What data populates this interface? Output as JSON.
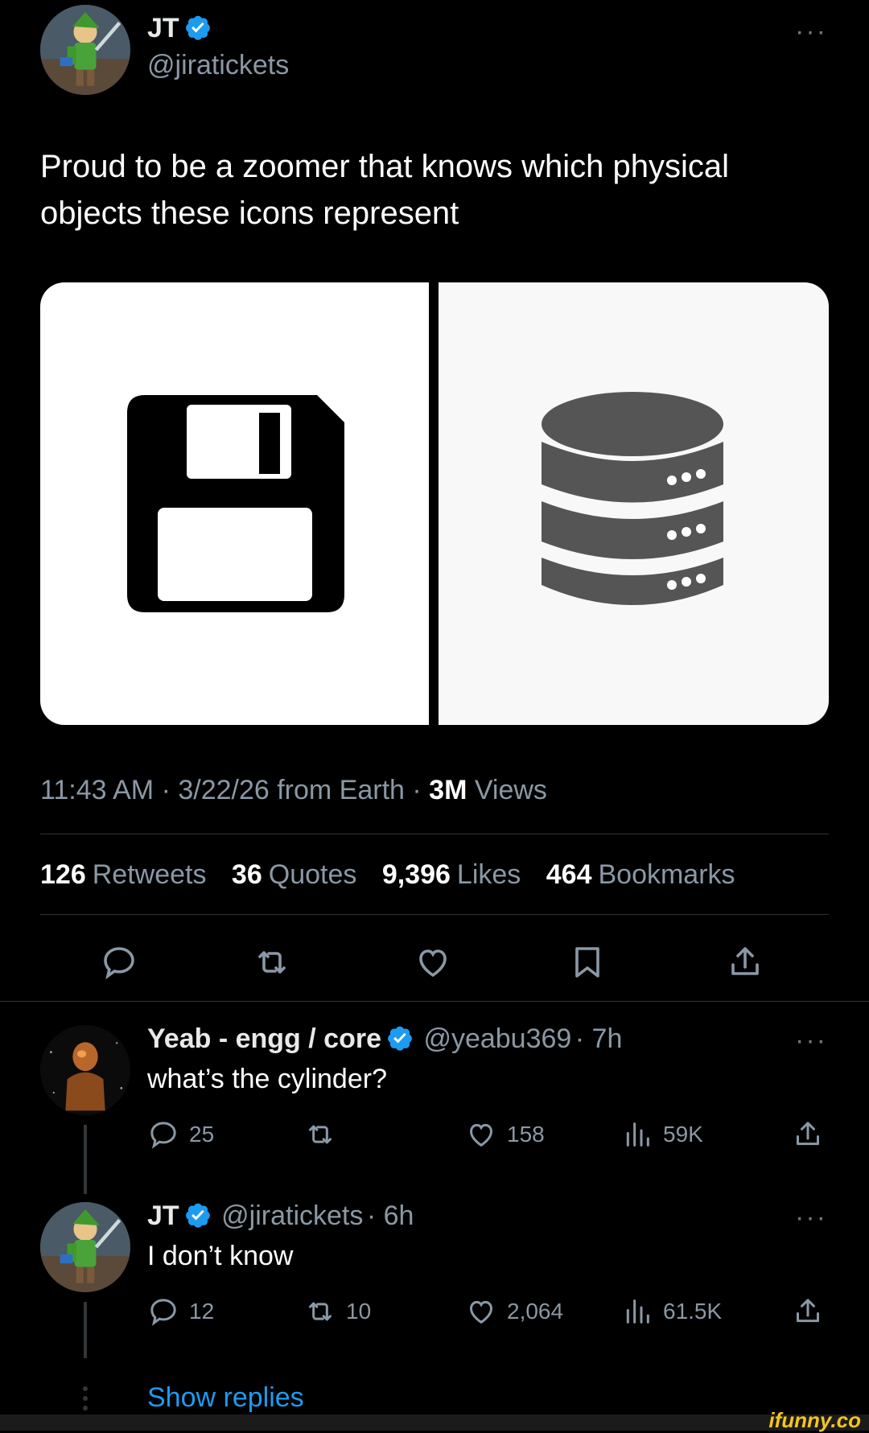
{
  "tweet": {
    "author_name": "JT",
    "author_handle": "@jiratickets",
    "more_label": "···",
    "text": "Proud to be a zoomer that knows which physical objects these icons represent",
    "time": "11:43 AM · 3/22/26 from Earth · ",
    "views_count": "3M",
    "views_label": " Views",
    "stats": {
      "retweets_count": "126",
      "retweets_label": "Retweets",
      "quotes_count": "36",
      "quotes_label": "Quotes",
      "likes_count": "9,396",
      "likes_label": "Likes",
      "bookmarks_count": "464",
      "bookmarks_label": "Bookmarks"
    },
    "media": [
      {
        "icon": "floppy-disk-icon"
      },
      {
        "icon": "database-icon"
      }
    ]
  },
  "replies": [
    {
      "name": "Yeab - engg / core",
      "handle": "@yeabu369",
      "time": "· 7h",
      "text": "what’s the cylinder?",
      "reply_count": "25",
      "retweet_count": "",
      "like_count": "158",
      "view_count": "59K"
    },
    {
      "name": "JT",
      "handle": "@jiratickets",
      "time": "· 6h",
      "text": "I don’t know",
      "reply_count": "12",
      "retweet_count": "10",
      "like_count": "2,064",
      "view_count": "61.5K"
    }
  ],
  "show_replies_label": "Show replies",
  "colors": {
    "background": "#000000",
    "link": "#1d9bf0",
    "muted": "#8b98a5",
    "verified": "#1d9bf0"
  },
  "watermark": "ifunny.co"
}
